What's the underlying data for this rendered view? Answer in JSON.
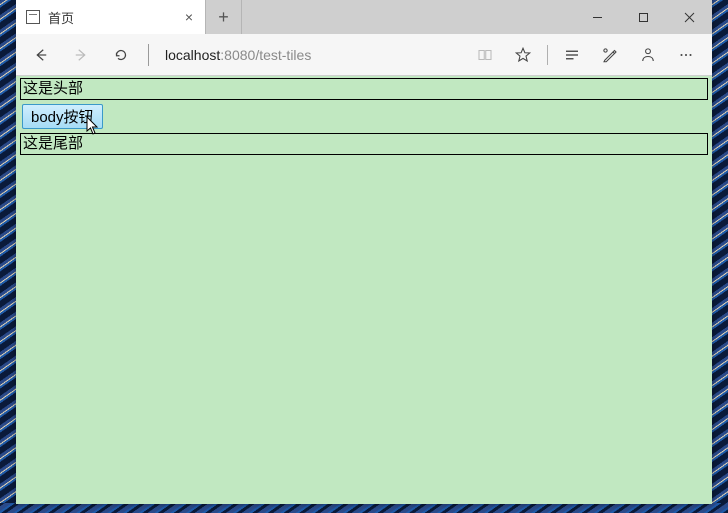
{
  "tab": {
    "title": "首页",
    "close_label": "×"
  },
  "new_tab_label": "+",
  "address": {
    "host": "localhost",
    "port": ":8080",
    "path": "/test-tiles"
  },
  "icons": {
    "back": "back-icon",
    "forward": "forward-icon",
    "refresh": "refresh-icon",
    "reading": "reading-icon",
    "favorite": "favorite-icon",
    "readlist": "reading-list-icon",
    "notes": "web-notes-icon",
    "share": "share-icon",
    "more": "more-icon",
    "minimize": "minimize-icon",
    "maximize": "maximize-icon",
    "close_window": "close-window-icon",
    "page": "page-icon"
  },
  "page": {
    "header_text": "这是头部",
    "body_button_label": "body按钮",
    "footer_text": "这是尾部"
  }
}
